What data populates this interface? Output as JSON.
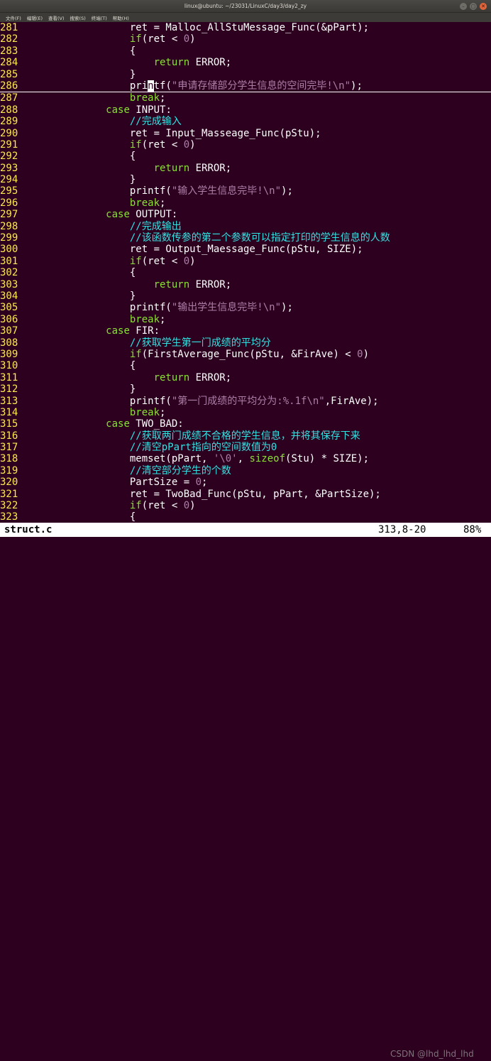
{
  "window": {
    "title": "linux@ubuntu: ~/23031/LinuxC/day3/day2_zy",
    "buttons": [
      "–",
      "▢",
      "✕"
    ]
  },
  "menu": [
    "文件(F)",
    "编辑(E)",
    "查看(V)",
    "搜索(S)",
    "终端(T)",
    "帮助(H)"
  ],
  "editor": {
    "lines": [
      {
        "n": "281",
        "t": [
          [
            "                ret = Malloc_AllStuMessage_Func(&pPart);",
            ""
          ]
        ]
      },
      {
        "n": "282",
        "t": [
          [
            "                ",
            ""
          ],
          [
            "if",
            "kw"
          ],
          [
            "(ret < ",
            ""
          ],
          [
            "0",
            "num"
          ],
          [
            ")",
            ""
          ]
        ]
      },
      {
        "n": "283",
        "t": [
          [
            "                {",
            ""
          ]
        ]
      },
      {
        "n": "284",
        "t": [
          [
            "                    ",
            ""
          ],
          [
            "return",
            "kw"
          ],
          [
            " ERROR;",
            ""
          ]
        ]
      },
      {
        "n": "285",
        "t": [
          [
            "                }",
            ""
          ]
        ]
      },
      {
        "n": "286",
        "cursorline": true,
        "t": [
          [
            "                pri",
            ""
          ],
          [
            "n",
            "cursor"
          ],
          [
            "tf(",
            ""
          ],
          [
            "\"申请存储部分学生信息的空间完毕!\\n\"",
            "str"
          ],
          [
            ");",
            ""
          ]
        ]
      },
      {
        "n": "287",
        "t": [
          [
            "                ",
            ""
          ],
          [
            "break",
            "kw"
          ],
          [
            ";",
            ""
          ]
        ]
      },
      {
        "n": "288",
        "t": [
          [
            "            ",
            ""
          ],
          [
            "case",
            "kw"
          ],
          [
            " INPUT:",
            ""
          ]
        ]
      },
      {
        "n": "289",
        "t": [
          [
            "                ",
            ""
          ],
          [
            "//完成输入",
            "cmt"
          ]
        ]
      },
      {
        "n": "290",
        "t": [
          [
            "                ret = Input_Masseage_Func(pStu);",
            ""
          ]
        ]
      },
      {
        "n": "291",
        "t": [
          [
            "                ",
            ""
          ],
          [
            "if",
            "kw"
          ],
          [
            "(ret < ",
            ""
          ],
          [
            "0",
            "num"
          ],
          [
            ")",
            ""
          ]
        ]
      },
      {
        "n": "292",
        "t": [
          [
            "                {",
            ""
          ]
        ]
      },
      {
        "n": "293",
        "t": [
          [
            "                    ",
            ""
          ],
          [
            "return",
            "kw"
          ],
          [
            " ERROR;",
            ""
          ]
        ]
      },
      {
        "n": "294",
        "t": [
          [
            "                }",
            ""
          ]
        ]
      },
      {
        "n": "295",
        "t": [
          [
            "                printf(",
            ""
          ],
          [
            "\"输入学生信息完毕!\\n\"",
            "str"
          ],
          [
            ");",
            ""
          ]
        ]
      },
      {
        "n": "296",
        "t": [
          [
            "                ",
            ""
          ],
          [
            "break",
            "kw"
          ],
          [
            ";",
            ""
          ]
        ]
      },
      {
        "n": "297",
        "t": [
          [
            "            ",
            ""
          ],
          [
            "case",
            "kw"
          ],
          [
            " OUTPUT:",
            ""
          ]
        ]
      },
      {
        "n": "298",
        "t": [
          [
            "                ",
            ""
          ],
          [
            "//完成输出",
            "cmt"
          ]
        ]
      },
      {
        "n": "299",
        "t": [
          [
            "                ",
            ""
          ],
          [
            "//该函数传参的第二个参数可以指定打印的学生信息的人数",
            "cmt"
          ]
        ]
      },
      {
        "n": "300",
        "t": [
          [
            "                ret = Output_Maessage_Func(pStu, SIZE);",
            ""
          ]
        ]
      },
      {
        "n": "301",
        "t": [
          [
            "                ",
            ""
          ],
          [
            "if",
            "kw"
          ],
          [
            "(ret < ",
            ""
          ],
          [
            "0",
            "num"
          ],
          [
            ")",
            ""
          ]
        ]
      },
      {
        "n": "302",
        "t": [
          [
            "                {",
            ""
          ]
        ]
      },
      {
        "n": "303",
        "t": [
          [
            "                    ",
            ""
          ],
          [
            "return",
            "kw"
          ],
          [
            " ERROR;",
            ""
          ]
        ]
      },
      {
        "n": "304",
        "t": [
          [
            "                }",
            ""
          ]
        ]
      },
      {
        "n": "305",
        "t": [
          [
            "                printf(",
            ""
          ],
          [
            "\"输出学生信息完毕!\\n\"",
            "str"
          ],
          [
            ");",
            ""
          ]
        ]
      },
      {
        "n": "306",
        "t": [
          [
            "                ",
            ""
          ],
          [
            "break",
            "kw"
          ],
          [
            ";",
            ""
          ]
        ]
      },
      {
        "n": "307",
        "t": [
          [
            "            ",
            ""
          ],
          [
            "case",
            "kw"
          ],
          [
            " FIR:",
            ""
          ]
        ]
      },
      {
        "n": "308",
        "t": [
          [
            "                ",
            ""
          ],
          [
            "//获取学生第一门成绩的平均分",
            "cmt"
          ]
        ]
      },
      {
        "n": "309",
        "t": [
          [
            "                ",
            ""
          ],
          [
            "if",
            "kw"
          ],
          [
            "(FirstAverage_Func(pStu, &FirAve) < ",
            ""
          ],
          [
            "0",
            "num"
          ],
          [
            ")",
            ""
          ]
        ]
      },
      {
        "n": "310",
        "t": [
          [
            "                {",
            ""
          ]
        ]
      },
      {
        "n": "311",
        "t": [
          [
            "                    ",
            ""
          ],
          [
            "return",
            "kw"
          ],
          [
            " ERROR;",
            ""
          ]
        ]
      },
      {
        "n": "312",
        "t": [
          [
            "                }",
            ""
          ]
        ]
      },
      {
        "n": "313",
        "t": [
          [
            "                printf(",
            ""
          ],
          [
            "\"第一门成绩的平均分为:%.1f\\n\"",
            "str"
          ],
          [
            ",FirAve);",
            ""
          ]
        ]
      },
      {
        "n": "314",
        "t": [
          [
            "                ",
            ""
          ],
          [
            "break",
            "kw"
          ],
          [
            ";",
            ""
          ]
        ]
      },
      {
        "n": "315",
        "t": [
          [
            "            ",
            ""
          ],
          [
            "case",
            "kw"
          ],
          [
            " TWO_BAD:",
            ""
          ]
        ]
      },
      {
        "n": "316",
        "t": [
          [
            "                ",
            ""
          ],
          [
            "//获取两门成绩不合格的学生信息，并将其保存下来",
            "cmt"
          ]
        ]
      },
      {
        "n": "317",
        "t": [
          [
            "                ",
            ""
          ],
          [
            "//清空pPart指向的空间数值为0",
            "cmt"
          ]
        ]
      },
      {
        "n": "318",
        "t": [
          [
            "                memset(pPart, ",
            ""
          ],
          [
            "'\\0'",
            "str"
          ],
          [
            ", ",
            ""
          ],
          [
            "sizeof",
            "kw"
          ],
          [
            "(Stu) * SIZE);",
            ""
          ]
        ]
      },
      {
        "n": "319",
        "t": [
          [
            "                ",
            ""
          ],
          [
            "//清空部分学生的个数",
            "cmt"
          ]
        ]
      },
      {
        "n": "320",
        "t": [
          [
            "                PartSize = ",
            ""
          ],
          [
            "0",
            "num"
          ],
          [
            ";",
            ""
          ]
        ]
      },
      {
        "n": "321",
        "t": [
          [
            "                ret = TwoBad_Func(pStu, pPart, &PartSize);",
            ""
          ]
        ]
      },
      {
        "n": "322",
        "t": [
          [
            "                ",
            ""
          ],
          [
            "if",
            "kw"
          ],
          [
            "(ret < ",
            ""
          ],
          [
            "0",
            "num"
          ],
          [
            ")",
            ""
          ]
        ]
      },
      {
        "n": "323",
        "t": [
          [
            "                {",
            ""
          ]
        ]
      }
    ]
  },
  "status": {
    "filename": "struct.c",
    "position": "313,8-20",
    "percent": "88%"
  },
  "watermark": "CSDN @lhd_lhd_lhd"
}
